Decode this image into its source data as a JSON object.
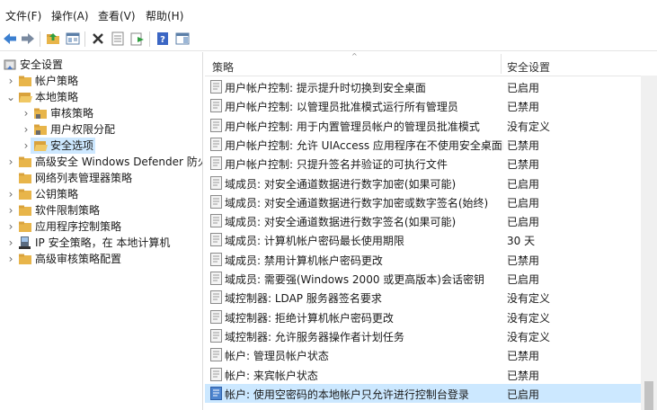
{
  "menu": {
    "file": "文件(F)",
    "action": "操作(A)",
    "view": "查看(V)",
    "help": "帮助(H)"
  },
  "toolbar_icons": [
    "back-arrow-icon",
    "forward-arrow-icon",
    "up-folder-icon",
    "console-tree-icon",
    "delete-icon",
    "properties-icon",
    "export-list-icon",
    "help-icon",
    "show-hide-icon"
  ],
  "tree": [
    {
      "label": "安全设置",
      "icon": "security-settings-icon",
      "expander": "",
      "selected": false
    },
    {
      "label": "帐户策略",
      "icon": "folder-icon",
      "expander": "›",
      "selected": false
    },
    {
      "label": "本地策略",
      "icon": "folder-open-icon",
      "expander": "⌄",
      "selected": false
    },
    {
      "label": "审核策略",
      "icon": "folder-icon",
      "expander": "›",
      "selected": false
    },
    {
      "label": "用户权限分配",
      "icon": "folder-icon",
      "expander": "›",
      "selected": false
    },
    {
      "label": "安全选项",
      "icon": "folder-open-icon",
      "expander": "›",
      "selected": true
    },
    {
      "label": "高级安全 Windows Defender 防火墙",
      "icon": "folder-icon",
      "expander": "›",
      "selected": false
    },
    {
      "label": "网络列表管理器策略",
      "icon": "folder-icon",
      "expander": "",
      "selected": false
    },
    {
      "label": "公钥策略",
      "icon": "folder-icon",
      "expander": "›",
      "selected": false
    },
    {
      "label": "软件限制策略",
      "icon": "folder-icon",
      "expander": "›",
      "selected": false
    },
    {
      "label": "应用程序控制策略",
      "icon": "folder-icon",
      "expander": "›",
      "selected": false
    },
    {
      "label": "IP 安全策略，在 本地计算机",
      "icon": "ip-security-icon",
      "expander": "›",
      "selected": false
    },
    {
      "label": "高级审核策略配置",
      "icon": "folder-icon",
      "expander": "›",
      "selected": false
    }
  ],
  "list": {
    "col_policy": "策略",
    "col_setting": "安全设置",
    "rows": [
      {
        "policy": "用户帐户控制: 提示提升时切换到安全桌面",
        "setting": "已启用"
      },
      {
        "policy": "用户帐户控制: 以管理员批准模式运行所有管理员",
        "setting": "已禁用"
      },
      {
        "policy": "用户帐户控制: 用于内置管理员帐户的管理员批准模式",
        "setting": "没有定义"
      },
      {
        "policy": "用户帐户控制: 允许 UIAccess 应用程序在不使用安全桌面的...",
        "setting": "已禁用"
      },
      {
        "policy": "用户帐户控制: 只提升签名并验证的可执行文件",
        "setting": "已禁用"
      },
      {
        "policy": "域成员: 对安全通道数据进行数字加密(如果可能)",
        "setting": "已启用"
      },
      {
        "policy": "域成员: 对安全通道数据进行数字加密或数字签名(始终)",
        "setting": "已启用"
      },
      {
        "policy": "域成员: 对安全通道数据进行数字签名(如果可能)",
        "setting": "已启用"
      },
      {
        "policy": "域成员: 计算机帐户密码最长使用期限",
        "setting": "30 天"
      },
      {
        "policy": "域成员: 禁用计算机帐户密码更改",
        "setting": "已禁用"
      },
      {
        "policy": "域成员: 需要强(Windows 2000 或更高版本)会话密钥",
        "setting": "已启用"
      },
      {
        "policy": "域控制器: LDAP 服务器签名要求",
        "setting": "没有定义"
      },
      {
        "policy": "域控制器: 拒绝计算机帐户密码更改",
        "setting": "没有定义"
      },
      {
        "policy": "域控制器: 允许服务器操作者计划任务",
        "setting": "没有定义"
      },
      {
        "policy": "帐户: 管理员帐户状态",
        "setting": "已禁用"
      },
      {
        "policy": "帐户: 来宾帐户状态",
        "setting": "已禁用"
      },
      {
        "policy": "帐户: 使用空密码的本地帐户只允许进行控制台登录",
        "setting": "已启用",
        "selected": true
      }
    ]
  },
  "colors": {
    "selection": "#cce8ff",
    "folder": "#e8b54a"
  }
}
